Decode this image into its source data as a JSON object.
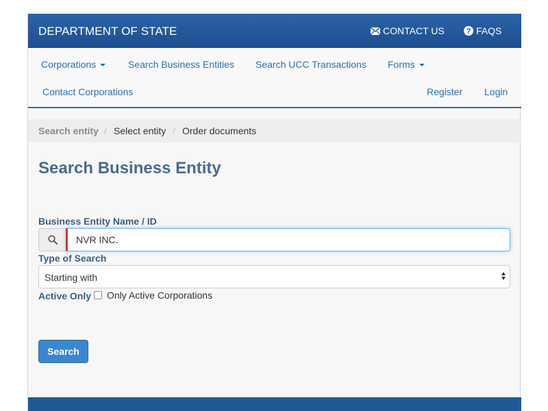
{
  "header": {
    "brand": "DEPARTMENT OF STATE",
    "contact_label": "CONTACT US",
    "faqs_label": "FAQS",
    "contact_icon": "envelope-icon",
    "faqs_icon": "question-circle-icon"
  },
  "nav": {
    "items": [
      {
        "label": "Corporations",
        "dropdown": true
      },
      {
        "label": "Search Business Entities",
        "dropdown": false
      },
      {
        "label": "Search UCC Transactions",
        "dropdown": false
      },
      {
        "label": "Forms",
        "dropdown": true
      },
      {
        "label": "Contact Corporations",
        "dropdown": false
      }
    ],
    "register_label": "Register",
    "login_label": "Login"
  },
  "breadcrumb": {
    "items": [
      "Search entity",
      "Select entity",
      "Order documents"
    ],
    "separator": "/"
  },
  "main": {
    "title": "Search Business Entity",
    "name_label": "Business Entity Name / ID",
    "name_value": "NVR INC.",
    "search_icon": "search-icon",
    "type_label": "Type of Search",
    "type_value": "Starting with",
    "active_label": "Active Only",
    "active_checkbox_label": "Only Active Corporations",
    "active_checked": false,
    "search_button": "Search"
  },
  "colors": {
    "header_bg": "#1d4e8f",
    "link": "#2a6fb0",
    "heading": "#4a6a8f",
    "label": "#3b5d82",
    "button": "#3a87cd",
    "input_focus": "#66afe9",
    "input_marker": "#e0302b"
  }
}
